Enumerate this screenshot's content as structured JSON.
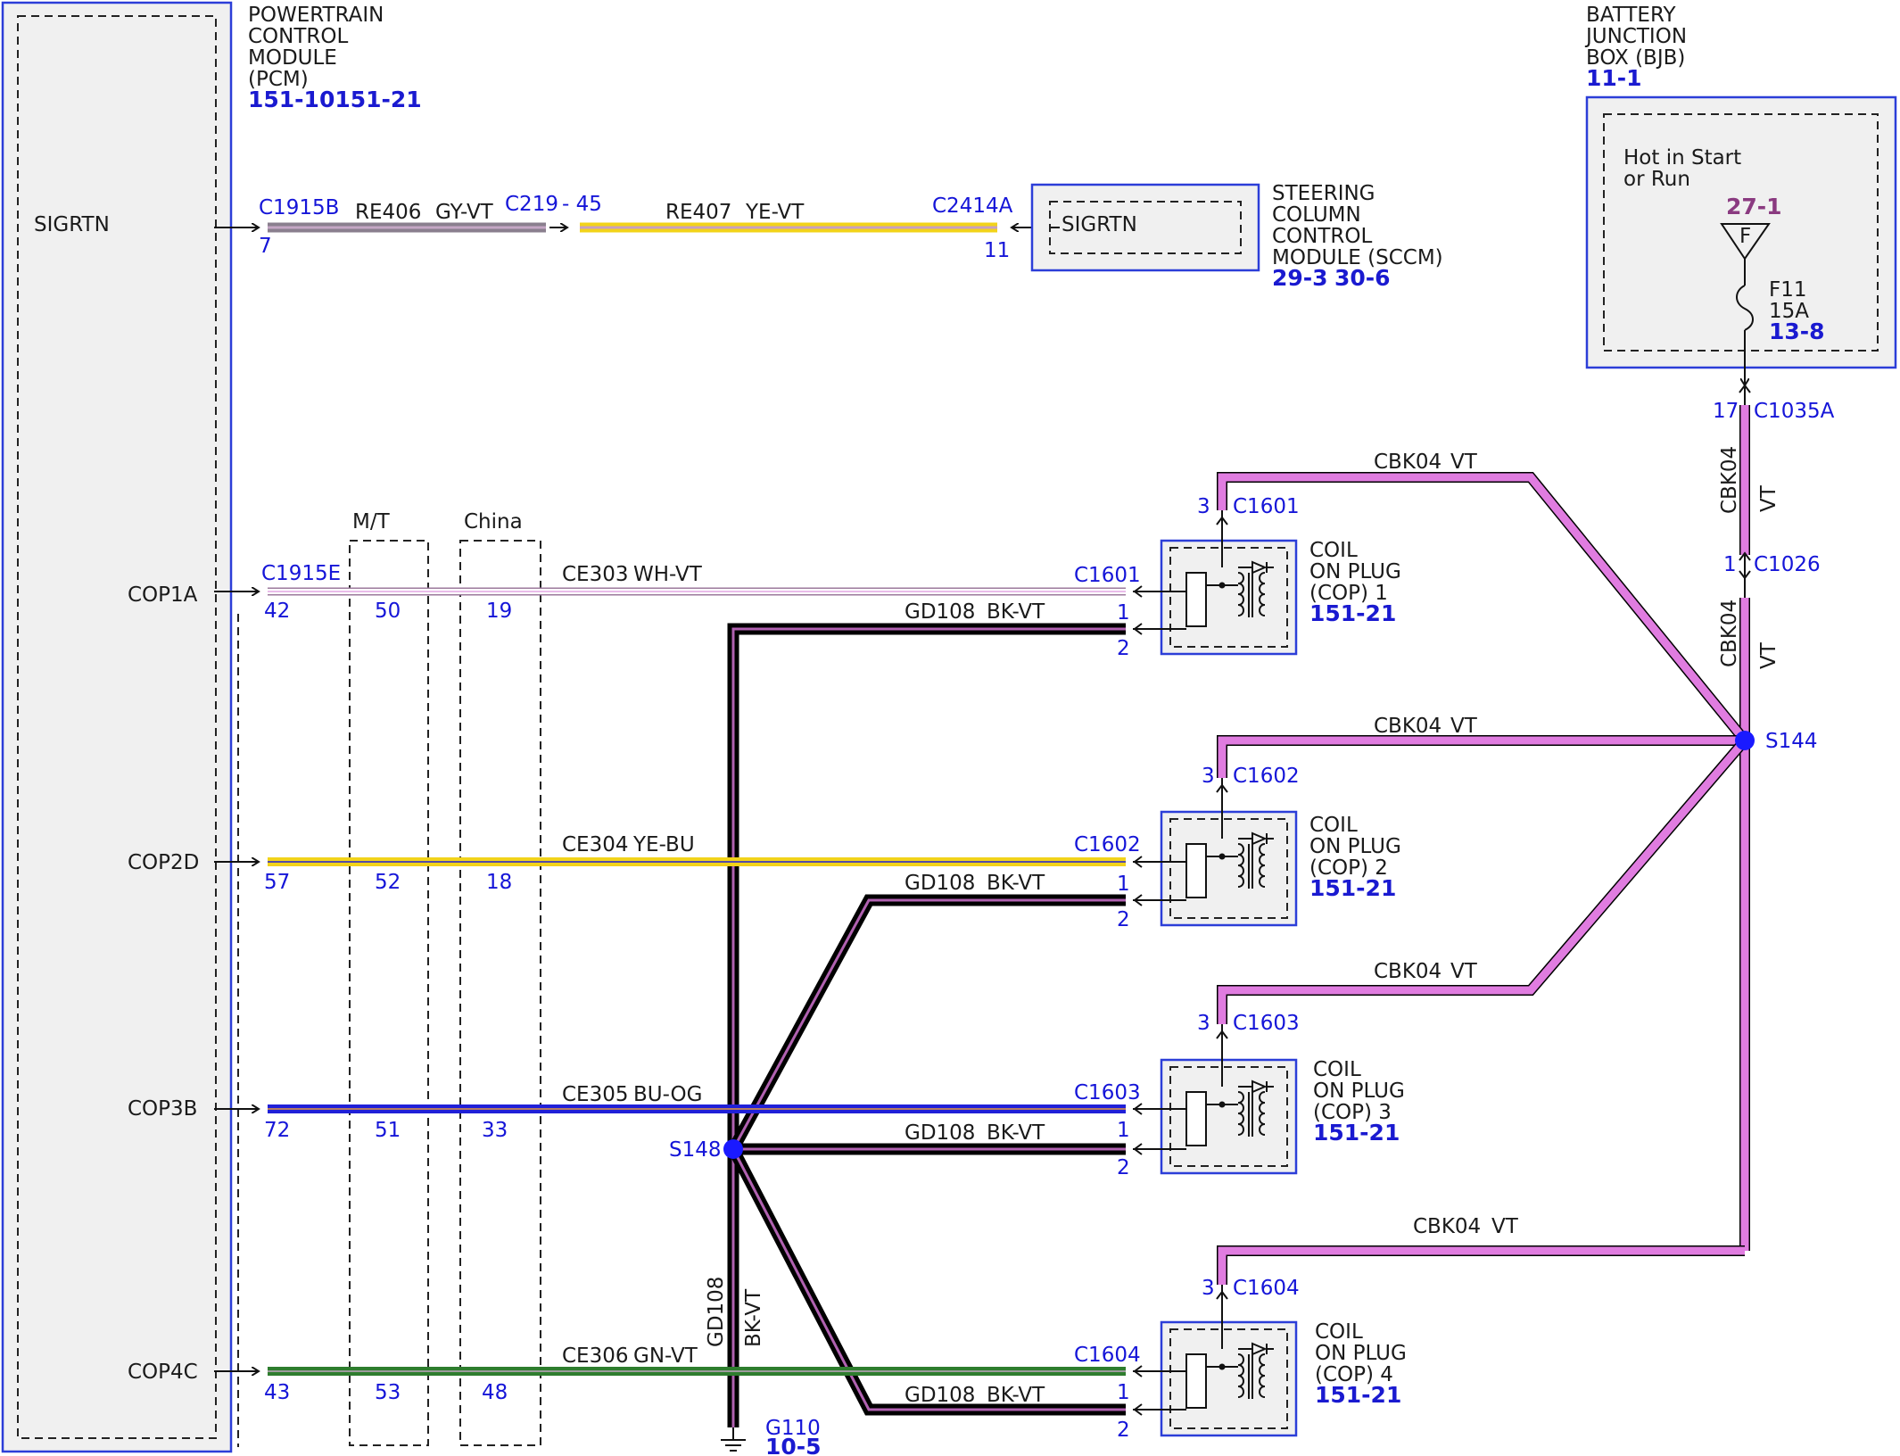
{
  "pcm": {
    "name_lines": [
      "POWERTRAIN",
      "CONTROL",
      "MODULE",
      "(PCM)"
    ],
    "ref": "151-10151-21",
    "pins": [
      "SIGRTN",
      "COP1A",
      "COP2D",
      "COP3B",
      "COP4C"
    ]
  },
  "bjb": {
    "name_lines": [
      "BATTERY",
      "JUNCTION",
      "BOX (BJB)"
    ],
    "ref": "11-1",
    "hot_lines": [
      "Hot in Start",
      "or Run"
    ],
    "fuse_ref": "27-1",
    "fuse_letter": "F",
    "fuse_id": "F11",
    "fuse_amp": "15A",
    "fuse_page": "13-8"
  },
  "sccm": {
    "name_lines": [
      "STEERING",
      "COLUMN",
      "CONTROL",
      "MODULE (SCCM)"
    ],
    "refs": [
      "29-3",
      "30-6"
    ],
    "pin": "SIGRTN"
  },
  "sigrtn_wire": {
    "c1": "C1915B",
    "c1_pin": "7",
    "w1": "RE406",
    "w1_color": "GY-VT",
    "c2": "C219",
    "c2_pin": "- 45",
    "w2": "RE407",
    "w2_color": "YE-VT",
    "c3": "C2414A",
    "c3_pin": "11"
  },
  "options": {
    "mt": "M/T",
    "china": "China"
  },
  "cop_rows": [
    {
      "pcm_conn": "C1915E",
      "pcm_pin": "42",
      "mt_pin": "50",
      "china_pin": "19",
      "circuit": "CE303",
      "color": "WH-VT",
      "conn": "C1601",
      "pin1": "1",
      "pin2": "2",
      "ground_circuit": "GD108",
      "ground_color": "BK-VT",
      "pin3": "3",
      "feed_conn": "C1601",
      "feed_circuit": "CBK04",
      "feed_color": "VT",
      "name_lines": [
        "COIL",
        "ON PLUG",
        "(COP) 1"
      ],
      "ref": "151-21"
    },
    {
      "pcm_conn": "",
      "pcm_pin": "57",
      "mt_pin": "52",
      "china_pin": "18",
      "circuit": "CE304",
      "color": "YE-BU",
      "conn": "C1602",
      "pin1": "1",
      "pin2": "2",
      "ground_circuit": "GD108",
      "ground_color": "BK-VT",
      "pin3": "3",
      "feed_conn": "C1602",
      "feed_circuit": "CBK04",
      "feed_color": "VT",
      "name_lines": [
        "COIL",
        "ON PLUG",
        "(COP) 2"
      ],
      "ref": "151-21"
    },
    {
      "pcm_conn": "",
      "pcm_pin": "72",
      "mt_pin": "51",
      "china_pin": "33",
      "circuit": "CE305",
      "color": "BU-OG",
      "conn": "C1603",
      "pin1": "1",
      "pin2": "2",
      "ground_circuit": "GD108",
      "ground_color": "BK-VT",
      "pin3": "3",
      "feed_conn": "C1603",
      "feed_circuit": "CBK04",
      "feed_color": "VT",
      "name_lines": [
        "COIL",
        "ON PLUG",
        "(COP) 3"
      ],
      "ref": "151-21"
    },
    {
      "pcm_conn": "",
      "pcm_pin": "43",
      "mt_pin": "53",
      "china_pin": "48",
      "circuit": "CE306",
      "color": "GN-VT",
      "conn": "C1604",
      "pin1": "1",
      "pin2": "2",
      "ground_circuit": "GD108",
      "ground_color": "BK-VT",
      "pin3": "3",
      "feed_conn": "C1604",
      "feed_circuit": "CBK04",
      "feed_color": "VT",
      "name_lines": [
        "COIL",
        "ON PLUG",
        "(COP) 4"
      ],
      "ref": "151-21"
    }
  ],
  "feed": {
    "c1035a": "C1035A",
    "c1035a_pin": "17",
    "c1026": "C1026",
    "c1026_pin": "1",
    "circuit": "CBK04",
    "color": "VT",
    "splice": "S144"
  },
  "ground": {
    "splice": "S148",
    "circuit": "GD108",
    "color": "BK-VT",
    "point": "G110",
    "ref": "10-5"
  },
  "wire_colors": {
    "gray_violet": "#8a7f8e",
    "yellow": "#f2d31a",
    "yellow_violet_stripe": "#c9a0c0",
    "white": "#ffffff",
    "violet": "#e07ce0",
    "blue": "#2020d8",
    "green": "#2e7d2e",
    "black": "#111111",
    "module_border": "#2c3ed8",
    "module_fill": "#f0f0f0",
    "splice_dot": "#1a1aff"
  }
}
